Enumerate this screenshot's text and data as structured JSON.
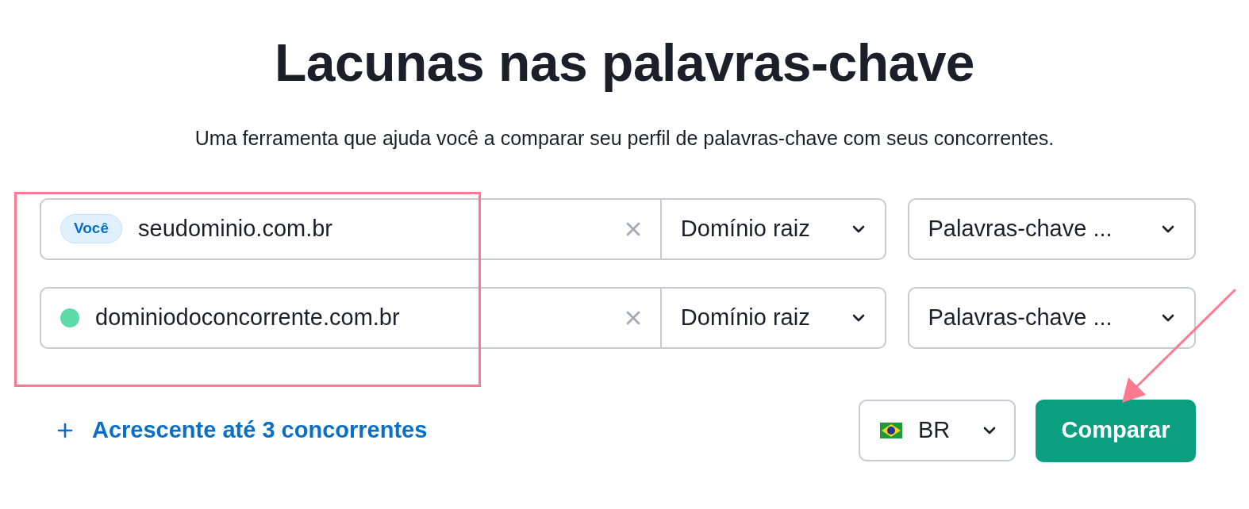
{
  "title": "Lacunas nas palavras-chave",
  "subtitle": "Uma ferramenta que ajuda você a comparar seu perfil de palavras-chave com seus concorrentes.",
  "domain_rows": [
    {
      "kind": "you",
      "badge": "Você",
      "value": "seudominio.com.br",
      "scope": "Domínio raiz",
      "keyword_type": "Palavras-chave ..."
    },
    {
      "kind": "competitor",
      "color": "#5ddba8",
      "value": "dominiodoconcorrente.com.br",
      "scope": "Domínio raiz",
      "keyword_type": "Palavras-chave ..."
    }
  ],
  "add_link": "Acrescente até 3 concorrentes",
  "country": "BR",
  "compare_button": "Comparar"
}
